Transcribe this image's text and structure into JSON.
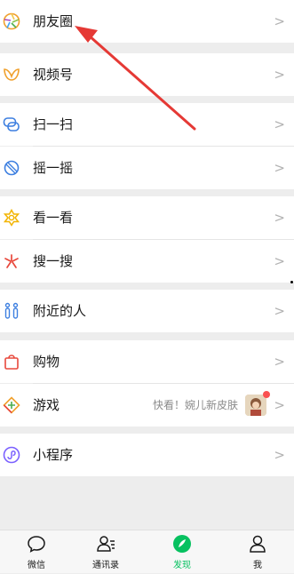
{
  "menu": {
    "moments": "朋友圈",
    "channels": "视频号",
    "scan": "扫一扫",
    "shake": "摇一摇",
    "top_stories": "看一看",
    "search": "搜一搜",
    "nearby": "附近的人",
    "shopping": "购物",
    "games": "游戏",
    "games_hint": "快看！婉儿新皮肤",
    "mini_programs": "小程序",
    "chevron": ">"
  },
  "tabs": [
    {
      "label": "微信",
      "icon": "chat-bubble-icon",
      "active": false
    },
    {
      "label": "通讯录",
      "icon": "contacts-icon",
      "active": false
    },
    {
      "label": "发现",
      "icon": "compass-icon",
      "active": true
    },
    {
      "label": "我",
      "icon": "person-icon",
      "active": false
    }
  ],
  "colors": {
    "accent": "#07c160",
    "annotation_arrow": "#e53935",
    "badge": "#fa5151"
  }
}
